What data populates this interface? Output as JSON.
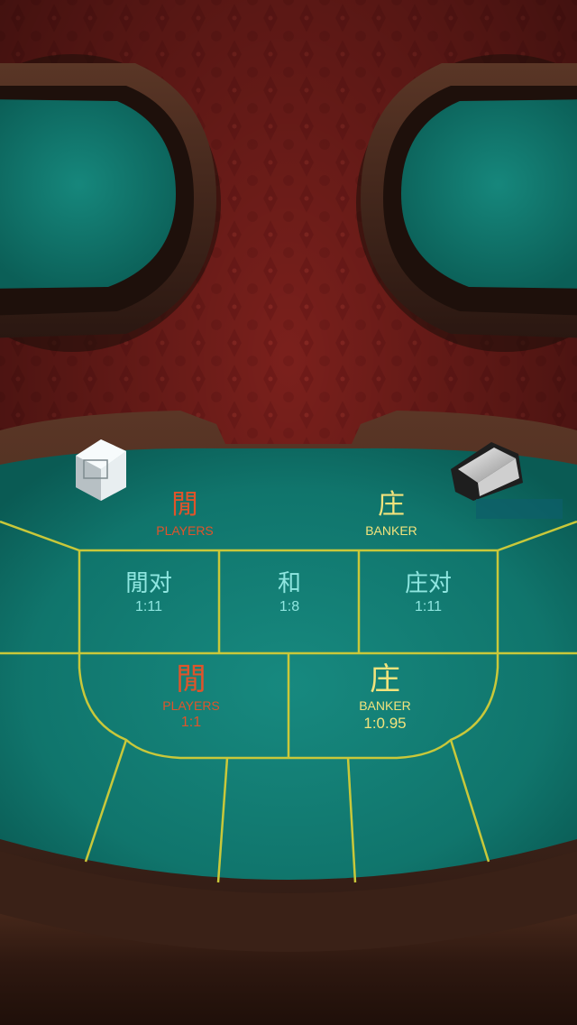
{
  "colors": {
    "player": "#e0542a",
    "banker": "#f2e37c",
    "pair_tie": "#8fe6e0",
    "felt": "#137d74",
    "line": "#c9c83a",
    "carpet": "#7a1f1b",
    "wood": "#3b2117"
  },
  "top_row": {
    "player": {
      "cn": "閒",
      "en": "PLAYERS"
    },
    "banker": {
      "cn": "庄",
      "en": "BANKER"
    }
  },
  "middle_row": {
    "player_pair": {
      "cn": "閒对",
      "odds": "1:11"
    },
    "tie": {
      "cn": "和",
      "odds": "1:8"
    },
    "banker_pair": {
      "cn": "庄对",
      "odds": "1:11"
    }
  },
  "main_bets": {
    "player": {
      "cn": "閒",
      "en": "PLAYERS",
      "odds": "1:1"
    },
    "banker": {
      "cn": "庄",
      "en": "BANKER",
      "odds": "1:0.95"
    }
  },
  "icons": {
    "discard_tray": "discard-tray-icon",
    "card_shoe": "card-shoe-icon"
  }
}
